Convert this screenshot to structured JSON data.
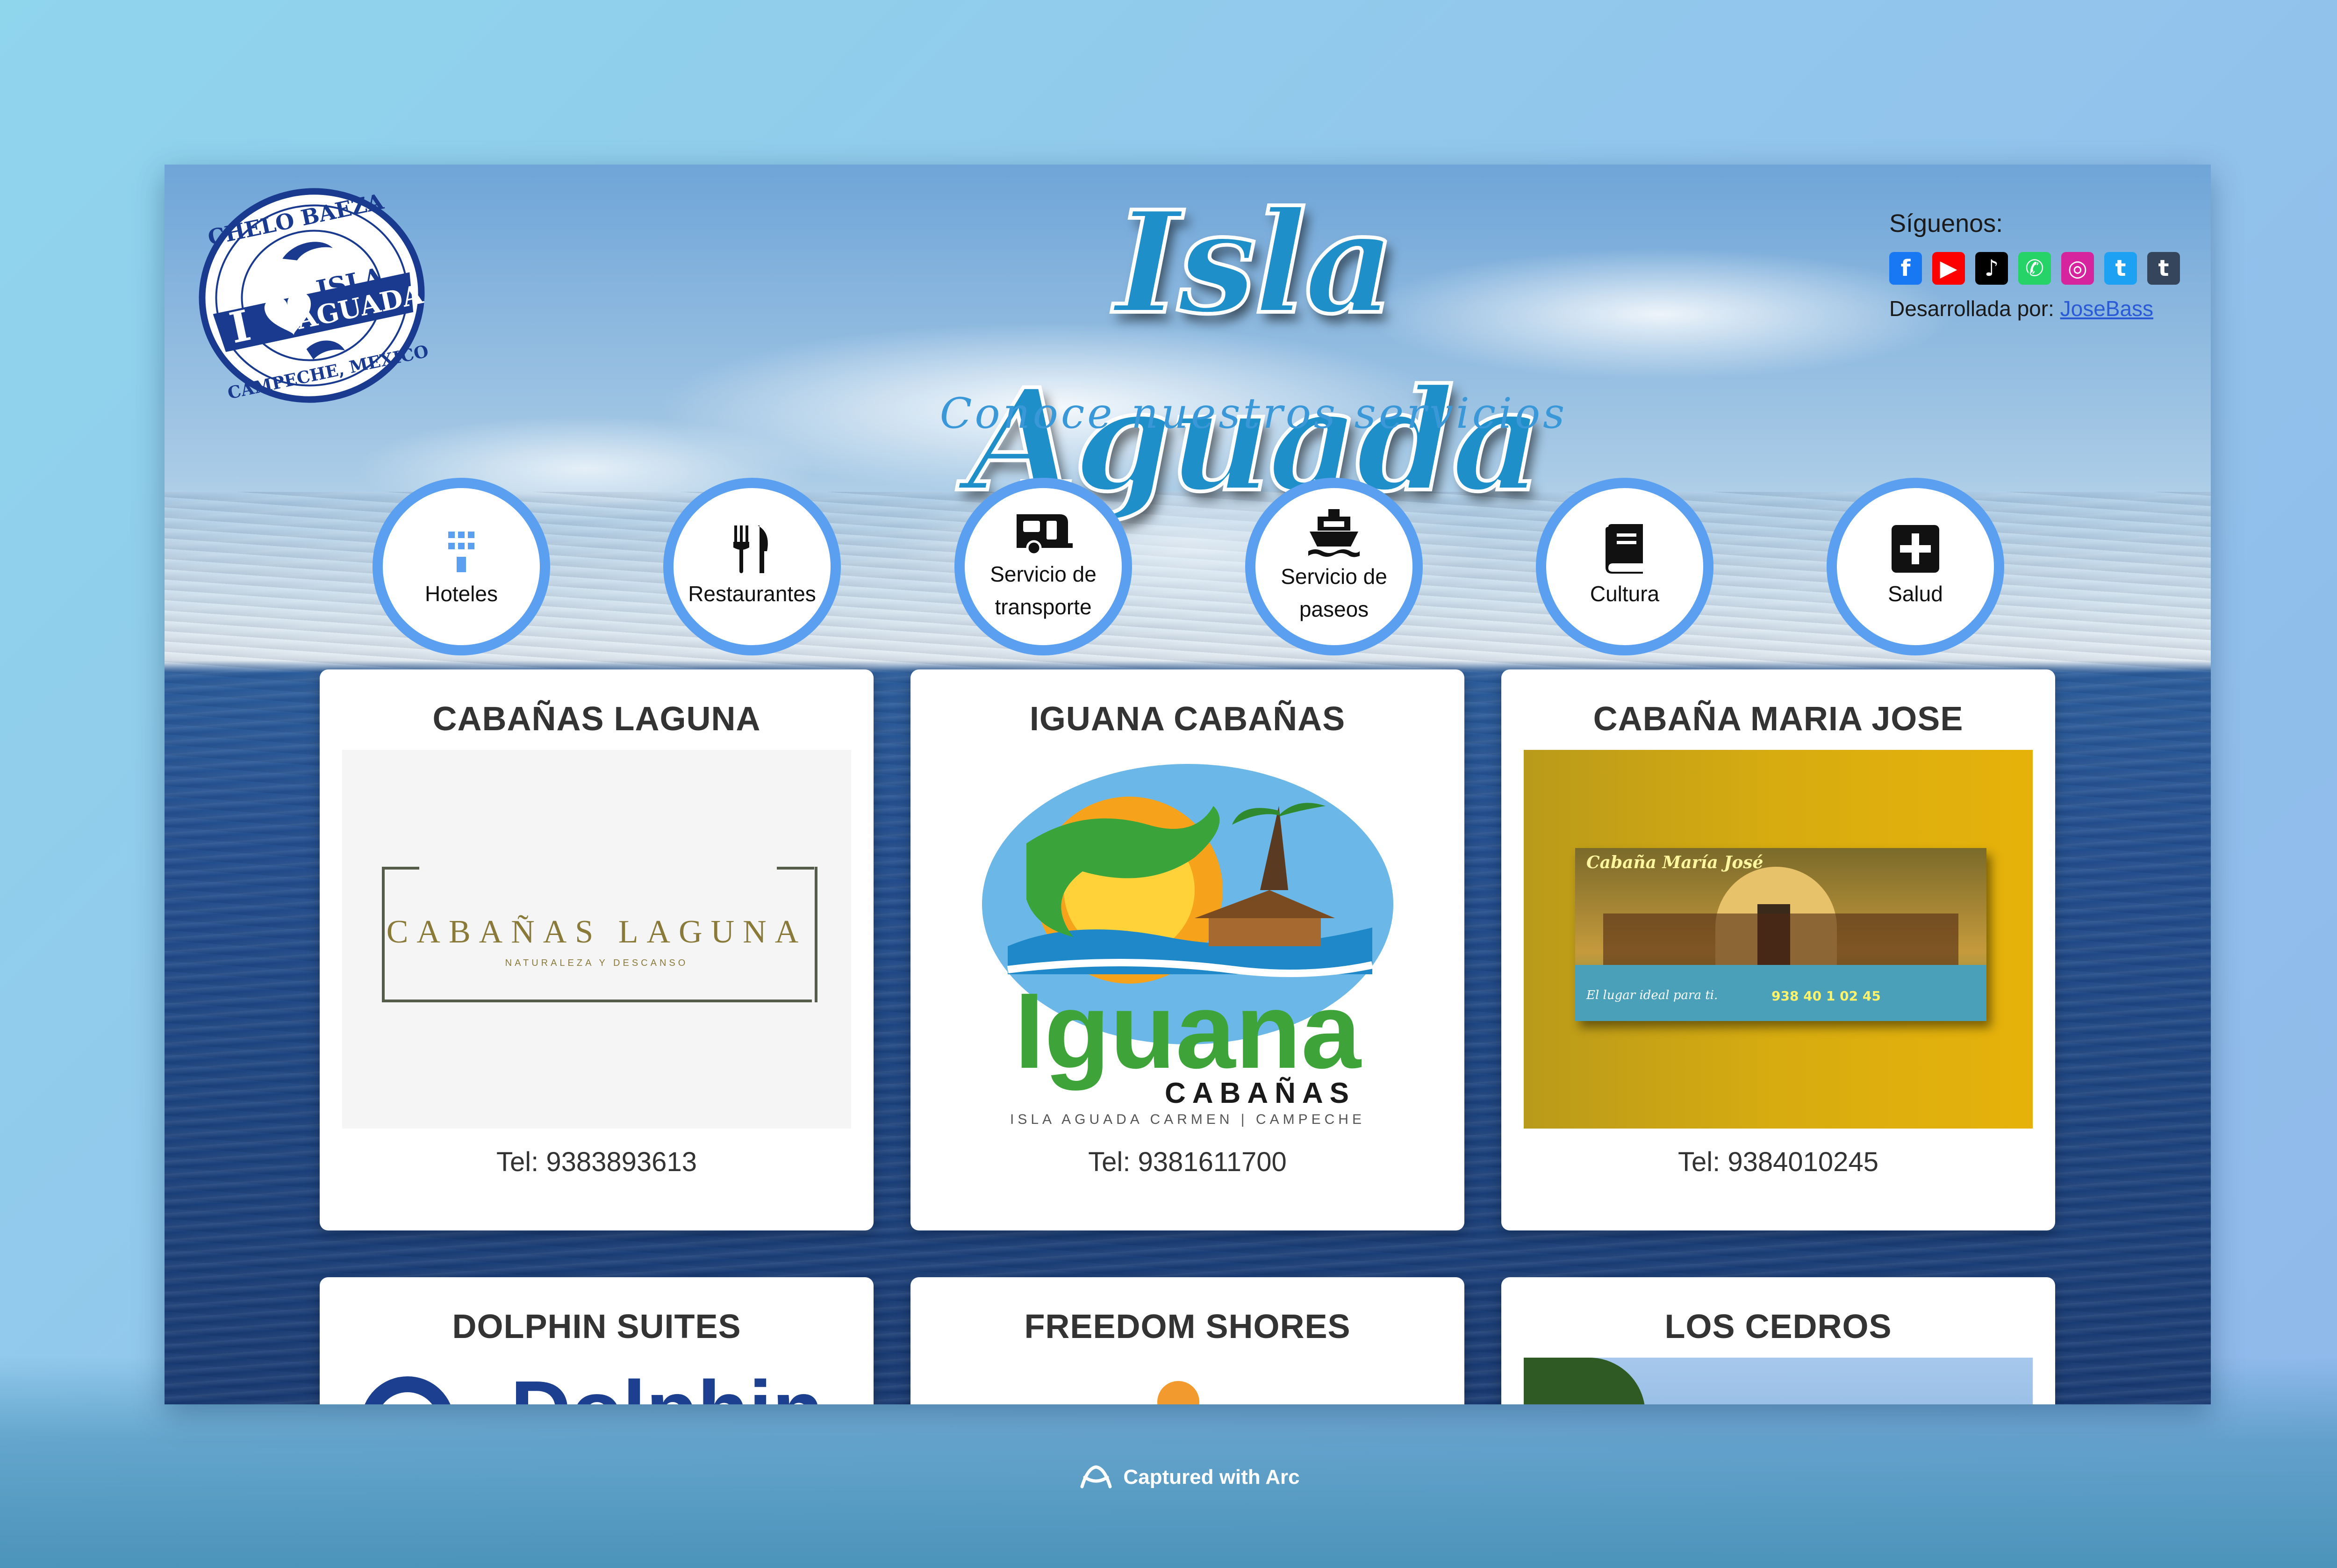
{
  "header": {
    "title": "Isla Aguada",
    "subtitle": "Conoce nuestros servicios",
    "logo": {
      "top_text": "CHELO BAEZA",
      "heart_text": "I",
      "line1": "ISLA",
      "line2": "AGUADA",
      "bottom_text": "CAMPECHE, MEXICO",
      "color": "#1a3a8f"
    }
  },
  "social": {
    "label": "Síguenos:",
    "icons": [
      {
        "name": "facebook-icon",
        "glyph": "f",
        "color": "#1877f2"
      },
      {
        "name": "youtube-icon",
        "glyph": "▶",
        "color": "#ff0000"
      },
      {
        "name": "tiktok-icon",
        "glyph": "♪",
        "color": "#000000"
      },
      {
        "name": "whatsapp-icon",
        "glyph": "✆",
        "color": "#25d366"
      },
      {
        "name": "instagram-icon",
        "glyph": "◎",
        "color": "#d6249f"
      },
      {
        "name": "twitter-icon",
        "glyph": "t",
        "color": "#1da1f2"
      },
      {
        "name": "tumblr-icon",
        "glyph": "t",
        "color": "#35465c"
      }
    ],
    "developed_by_label": "Desarrollada por:",
    "developer_link": "JoseBass"
  },
  "nav": {
    "items": [
      {
        "id": "hoteles",
        "label": "Hoteles",
        "icon": "hotel-icon",
        "active": true
      },
      {
        "id": "restaurantes",
        "label": "Restaurantes",
        "icon": "utensils-icon",
        "active": false
      },
      {
        "id": "transporte",
        "label": "Servicio de transporte",
        "icon": "caravan-icon",
        "active": false
      },
      {
        "id": "paseos",
        "label": "Servicio de paseos",
        "icon": "ship-icon",
        "active": false
      },
      {
        "id": "cultura",
        "label": "Cultura",
        "icon": "book-icon",
        "active": false
      },
      {
        "id": "salud",
        "label": "Salud",
        "icon": "plus-square-icon",
        "active": false
      }
    ]
  },
  "cards": [
    {
      "title": "CABAÑAS LAGUNA",
      "tel": "Tel: 9383893613",
      "image_text": "CABAÑAS LAGUNA",
      "image_subtext": "NATURALEZA Y DESCANSO"
    },
    {
      "title": "IGUANA CABAÑAS",
      "tel": "Tel: 9381611700",
      "image_text": "Iguana",
      "image_subtext": "CABAÑAS",
      "image_caption": "ISLA AGUADA CARMEN | CAMPECHE"
    },
    {
      "title": "CABAÑA MARIA JOSE",
      "tel": "Tel: 9384010245",
      "image_text": "Cabaña María José",
      "image_subtext": "El lugar ideal para ti.",
      "image_phone": "938 40 1 02 45"
    },
    {
      "title": "DOLPHIN SUITES"
    },
    {
      "title": "FREEDOM SHORES"
    },
    {
      "title": "LOS CEDROS"
    }
  ],
  "footer": {
    "captured_text": "Captured with Arc"
  }
}
